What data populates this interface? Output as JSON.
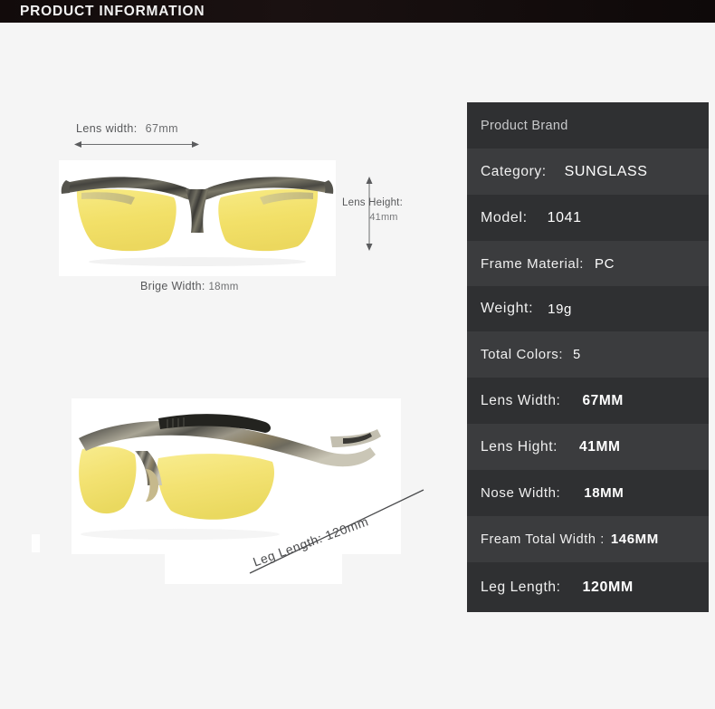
{
  "header": {
    "title": "PRODUCT INFORMATION",
    "background_color": "#140d0d",
    "text_color": "#f2f2f2"
  },
  "page": {
    "background_color": "#f5f5f5"
  },
  "diagram": {
    "lens_width": {
      "label": "Lens width:",
      "value": "67mm",
      "arrow": "horizontal-double-arrow"
    },
    "lens_height": {
      "label": "Lens Height:",
      "value": "41mm",
      "arrow": "vertical-double-arrow"
    },
    "bridge_width": {
      "label": "Brige Width:",
      "value": "18mm"
    },
    "leg_length": {
      "label": "Leg Length: 120mm",
      "arrow": "diagonal-line"
    },
    "images": [
      {
        "name": "sunglasses-front-view",
        "lens_color": "#f2e06a",
        "frame_color": "#5b5a52"
      },
      {
        "name": "sunglasses-angled-view",
        "lens_color": "#f3e272",
        "frame_color": "#8d8a7e"
      }
    ]
  },
  "specs": {
    "panel_background": "#2e2f31",
    "row_odd_color": "#2f3032",
    "row_even_color": "#3b3c3e",
    "rows": [
      {
        "label": "Product Brand",
        "value": ""
      },
      {
        "label": "Category:",
        "value": "SUNGLASS"
      },
      {
        "label": "Model:",
        "value": "1041"
      },
      {
        "label": "Frame Material:",
        "value": "PC"
      },
      {
        "label": "Weight:",
        "value": "19g"
      },
      {
        "label": "Total Colors:",
        "value": "5"
      },
      {
        "label": "Lens Width:",
        "value": "67MM"
      },
      {
        "label": "Lens Hight:",
        "value": "41MM"
      },
      {
        "label": "Nose Width:",
        "value": "18MM"
      },
      {
        "label": "Fream Total Width :",
        "value": "146MM"
      },
      {
        "label": "Leg Length:",
        "value": "120MM"
      }
    ]
  }
}
